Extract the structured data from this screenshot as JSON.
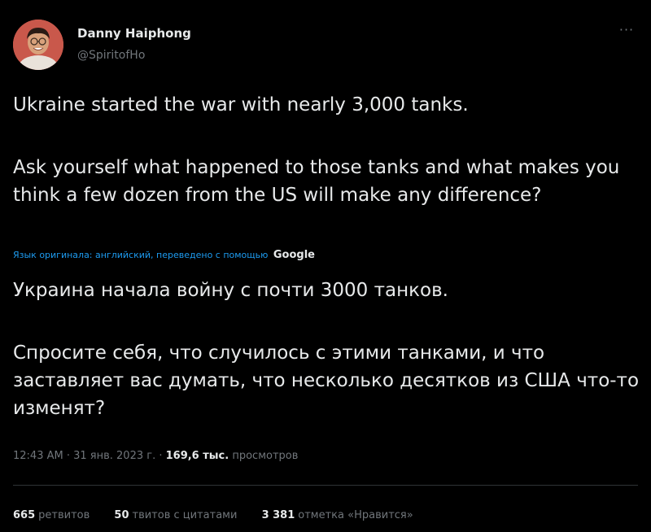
{
  "author": {
    "name": "Danny Haiphong",
    "handle": "@SpiritofHo"
  },
  "original_text": {
    "paragraph1": "Ukraine started the war with nearly 3,000 tanks.",
    "paragraph2": "Ask yourself what happened to those tanks and what makes you think a few dozen from the US will make any difference?"
  },
  "translation_note": {
    "text": "Язык оригинала: английский, переведено с помощью",
    "provider": "Google"
  },
  "translated_text": {
    "paragraph1": "Украина начала войну с почти 3000 танков.",
    "paragraph2": "Спросите себя, что случилось с этими танками, и что заставляет вас думать, что несколько десятков из США что-то изменят?"
  },
  "meta": {
    "datetime": "12:43 AM · 31 янв. 2023 г. ·",
    "views_count": "169,6 тыс.",
    "views_label": "просмотров"
  },
  "stats": {
    "retweets_count": "665",
    "retweets_label": "ретвитов",
    "quotes_count": "50",
    "quotes_label": "твитов с цитатами",
    "likes_count": "3 381",
    "likes_label": "отметка «Нравится»"
  },
  "icons": {
    "more": "more-options-icon"
  }
}
